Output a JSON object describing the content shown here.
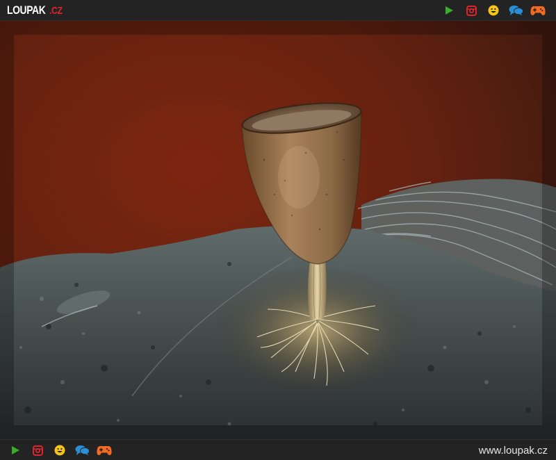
{
  "header": {
    "logo_main": "LOUPAK",
    "logo_tld": ".CZ",
    "icons": [
      "play-icon",
      "instagram-icon",
      "smiley-icon",
      "chat-icon",
      "gamepad-icon"
    ]
  },
  "photo": {
    "subject": "slime-mould-cup"
  },
  "footer": {
    "url": "www.loupak.cz",
    "icons": [
      "play-icon",
      "instagram-icon",
      "smiley-icon",
      "chat-icon",
      "gamepad-icon"
    ]
  },
  "colors": {
    "bar_bg": "#232323",
    "play_green": "#3aae2b",
    "instagram_red": "#e0242b",
    "smiley_yellow": "#f5c518",
    "chat_blue": "#2a8fd6",
    "gamepad_orange": "#f26b21",
    "logo_red": "#e0242b"
  }
}
